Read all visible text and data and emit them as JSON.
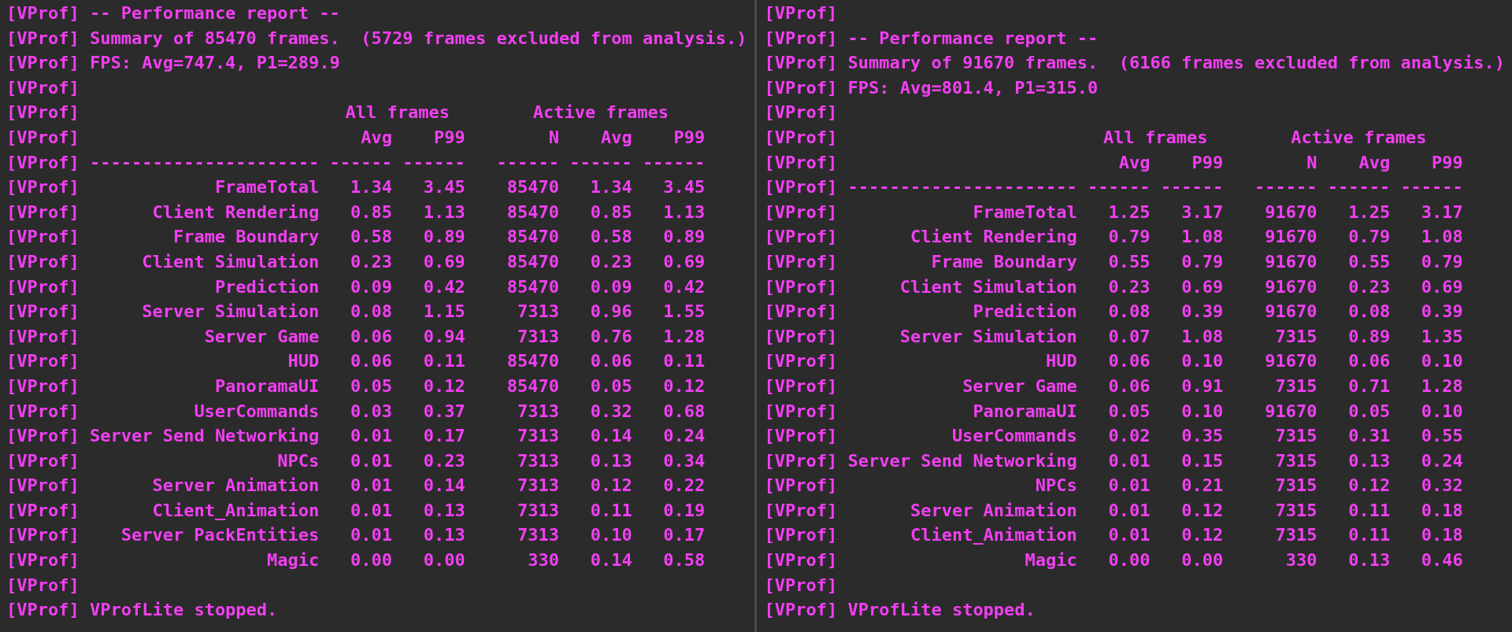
{
  "panes": [
    {
      "lines": [
        {
          "kind": "text",
          "prefix": "[VProf]",
          "text": "-- Performance report --"
        },
        {
          "kind": "text",
          "prefix": "[VProf]",
          "text": "Summary of 85470 frames.  (5729 frames excluded from analysis.)"
        },
        {
          "kind": "text",
          "prefix": "[VProf]",
          "text": "FPS: Avg=747.4, P1=289.9"
        },
        {
          "kind": "blank",
          "prefix": "[VProf]"
        },
        {
          "kind": "group_header",
          "prefix": "[VProf]",
          "labels": [
            "All frames",
            "Active frames"
          ]
        },
        {
          "kind": "column_header",
          "prefix": "[VProf]",
          "labels": [
            "Avg",
            "P99",
            "N",
            "Avg",
            "P99"
          ]
        },
        {
          "kind": "separator",
          "prefix": "[VProf]",
          "segments": [
            "----------------------",
            "------",
            "------",
            "------",
            "------",
            "------"
          ]
        },
        {
          "kind": "row",
          "prefix": "[VProf]",
          "name": "FrameTotal",
          "values": [
            "1.34",
            "3.45",
            "85470",
            "1.34",
            "3.45"
          ]
        },
        {
          "kind": "row",
          "prefix": "[VProf]",
          "name": "Client Rendering",
          "values": [
            "0.85",
            "1.13",
            "85470",
            "0.85",
            "1.13"
          ]
        },
        {
          "kind": "row",
          "prefix": "[VProf]",
          "name": "Frame Boundary",
          "values": [
            "0.58",
            "0.89",
            "85470",
            "0.58",
            "0.89"
          ]
        },
        {
          "kind": "row",
          "prefix": "[VProf]",
          "name": "Client Simulation",
          "values": [
            "0.23",
            "0.69",
            "85470",
            "0.23",
            "0.69"
          ]
        },
        {
          "kind": "row",
          "prefix": "[VProf]",
          "name": "Prediction",
          "values": [
            "0.09",
            "0.42",
            "85470",
            "0.09",
            "0.42"
          ]
        },
        {
          "kind": "row",
          "prefix": "[VProf]",
          "name": "Server Simulation",
          "values": [
            "0.08",
            "1.15",
            "7313",
            "0.96",
            "1.55"
          ]
        },
        {
          "kind": "row",
          "prefix": "[VProf]",
          "name": "Server Game",
          "values": [
            "0.06",
            "0.94",
            "7313",
            "0.76",
            "1.28"
          ]
        },
        {
          "kind": "row",
          "prefix": "[VProf]",
          "name": "HUD",
          "values": [
            "0.06",
            "0.11",
            "85470",
            "0.06",
            "0.11"
          ]
        },
        {
          "kind": "row",
          "prefix": "[VProf]",
          "name": "PanoramaUI",
          "values": [
            "0.05",
            "0.12",
            "85470",
            "0.05",
            "0.12"
          ]
        },
        {
          "kind": "row",
          "prefix": "[VProf]",
          "name": "UserCommands",
          "values": [
            "0.03",
            "0.37",
            "7313",
            "0.32",
            "0.68"
          ]
        },
        {
          "kind": "row",
          "prefix": "[VProf]",
          "name": "Server Send Networking",
          "values": [
            "0.01",
            "0.17",
            "7313",
            "0.14",
            "0.24"
          ]
        },
        {
          "kind": "row",
          "prefix": "[VProf]",
          "name": "NPCs",
          "values": [
            "0.01",
            "0.23",
            "7313",
            "0.13",
            "0.34"
          ]
        },
        {
          "kind": "row",
          "prefix": "[VProf]",
          "name": "Server Animation",
          "values": [
            "0.01",
            "0.14",
            "7313",
            "0.12",
            "0.22"
          ]
        },
        {
          "kind": "row",
          "prefix": "[VProf]",
          "name": "Client_Animation",
          "values": [
            "0.01",
            "0.13",
            "7313",
            "0.11",
            "0.19"
          ]
        },
        {
          "kind": "row",
          "prefix": "[VProf]",
          "name": "Server PackEntities",
          "values": [
            "0.01",
            "0.13",
            "7313",
            "0.10",
            "0.17"
          ]
        },
        {
          "kind": "row",
          "prefix": "[VProf]",
          "name": "Magic",
          "values": [
            "0.00",
            "0.00",
            "330",
            "0.14",
            "0.58"
          ]
        },
        {
          "kind": "blank",
          "prefix": "[VProf]"
        },
        {
          "kind": "text",
          "prefix": "[VProf]",
          "text": "VProfLite stopped."
        }
      ]
    },
    {
      "lines": [
        {
          "kind": "blank",
          "prefix": "[VProf]"
        },
        {
          "kind": "text",
          "prefix": "[VProf]",
          "text": "-- Performance report --"
        },
        {
          "kind": "text",
          "prefix": "[VProf]",
          "text": "Summary of 91670 frames.  (6166 frames excluded from analysis.)"
        },
        {
          "kind": "text",
          "prefix": "[VProf]",
          "text": "FPS: Avg=801.4, P1=315.0"
        },
        {
          "kind": "blank",
          "prefix": "[VProf]"
        },
        {
          "kind": "group_header",
          "prefix": "[VProf]",
          "labels": [
            "All frames",
            "Active frames"
          ]
        },
        {
          "kind": "column_header",
          "prefix": "[VProf]",
          "labels": [
            "Avg",
            "P99",
            "N",
            "Avg",
            "P99"
          ]
        },
        {
          "kind": "separator",
          "prefix": "[VProf]",
          "segments": [
            "----------------------",
            "------",
            "------",
            "------",
            "------",
            "------"
          ]
        },
        {
          "kind": "row",
          "prefix": "[VProf]",
          "name": "FrameTotal",
          "values": [
            "1.25",
            "3.17",
            "91670",
            "1.25",
            "3.17"
          ]
        },
        {
          "kind": "row",
          "prefix": "[VProf]",
          "name": "Client Rendering",
          "values": [
            "0.79",
            "1.08",
            "91670",
            "0.79",
            "1.08"
          ]
        },
        {
          "kind": "row",
          "prefix": "[VProf]",
          "name": "Frame Boundary",
          "values": [
            "0.55",
            "0.79",
            "91670",
            "0.55",
            "0.79"
          ]
        },
        {
          "kind": "row",
          "prefix": "[VProf]",
          "name": "Client Simulation",
          "values": [
            "0.23",
            "0.69",
            "91670",
            "0.23",
            "0.69"
          ]
        },
        {
          "kind": "row",
          "prefix": "[VProf]",
          "name": "Prediction",
          "values": [
            "0.08",
            "0.39",
            "91670",
            "0.08",
            "0.39"
          ]
        },
        {
          "kind": "row",
          "prefix": "[VProf]",
          "name": "Server Simulation",
          "values": [
            "0.07",
            "1.08",
            "7315",
            "0.89",
            "1.35"
          ]
        },
        {
          "kind": "row",
          "prefix": "[VProf]",
          "name": "HUD",
          "values": [
            "0.06",
            "0.10",
            "91670",
            "0.06",
            "0.10"
          ]
        },
        {
          "kind": "row",
          "prefix": "[VProf]",
          "name": "Server Game",
          "values": [
            "0.06",
            "0.91",
            "7315",
            "0.71",
            "1.28"
          ]
        },
        {
          "kind": "row",
          "prefix": "[VProf]",
          "name": "PanoramaUI",
          "values": [
            "0.05",
            "0.10",
            "91670",
            "0.05",
            "0.10"
          ]
        },
        {
          "kind": "row",
          "prefix": "[VProf]",
          "name": "UserCommands",
          "values": [
            "0.02",
            "0.35",
            "7315",
            "0.31",
            "0.55"
          ]
        },
        {
          "kind": "row",
          "prefix": "[VProf]",
          "name": "Server Send Networking",
          "values": [
            "0.01",
            "0.15",
            "7315",
            "0.13",
            "0.24"
          ]
        },
        {
          "kind": "row",
          "prefix": "[VProf]",
          "name": "NPCs",
          "values": [
            "0.01",
            "0.21",
            "7315",
            "0.12",
            "0.32"
          ]
        },
        {
          "kind": "row",
          "prefix": "[VProf]",
          "name": "Server Animation",
          "values": [
            "0.01",
            "0.12",
            "7315",
            "0.11",
            "0.18"
          ]
        },
        {
          "kind": "row",
          "prefix": "[VProf]",
          "name": "Client_Animation",
          "values": [
            "0.01",
            "0.12",
            "7315",
            "0.11",
            "0.18"
          ]
        },
        {
          "kind": "row",
          "prefix": "[VProf]",
          "name": "Magic",
          "values": [
            "0.00",
            "0.00",
            "330",
            "0.13",
            "0.46"
          ]
        },
        {
          "kind": "blank",
          "prefix": "[VProf]"
        },
        {
          "kind": "text",
          "prefix": "[VProf]",
          "text": "VProfLite stopped."
        }
      ]
    }
  ]
}
